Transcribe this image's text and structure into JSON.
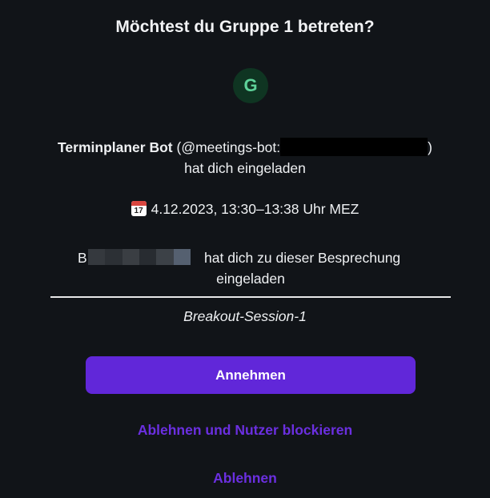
{
  "dialog": {
    "title": "Möchtest du Gruppe 1 betreten?",
    "avatar_letter": "G",
    "inviter": {
      "name": "Terminplaner Bot",
      "handle_prefix": "(@meetings-bot:",
      "handle_suffix": ")",
      "invited_text": "hat dich eingeladen"
    },
    "meeting": {
      "calendar_icon_day": "17",
      "time_text": "4.12.2023, 13:30–13:38 Uhr MEZ"
    },
    "meeting_invite": {
      "inviter_initial": "B",
      "text_line1": "hat dich zu dieser Besprechung",
      "text_line2": "eingeladen"
    },
    "session_name": "Breakout-Session-1",
    "accept_label": "Annehmen",
    "decline_block_label": "Ablehnen und Nutzer blockieren",
    "decline_label": "Ablehnen"
  },
  "colors": {
    "background": "#111418",
    "accent": "#6127d9",
    "link": "#6b2fe0",
    "avatar_bg": "#0f3522",
    "avatar_fg": "#5ed39a"
  }
}
